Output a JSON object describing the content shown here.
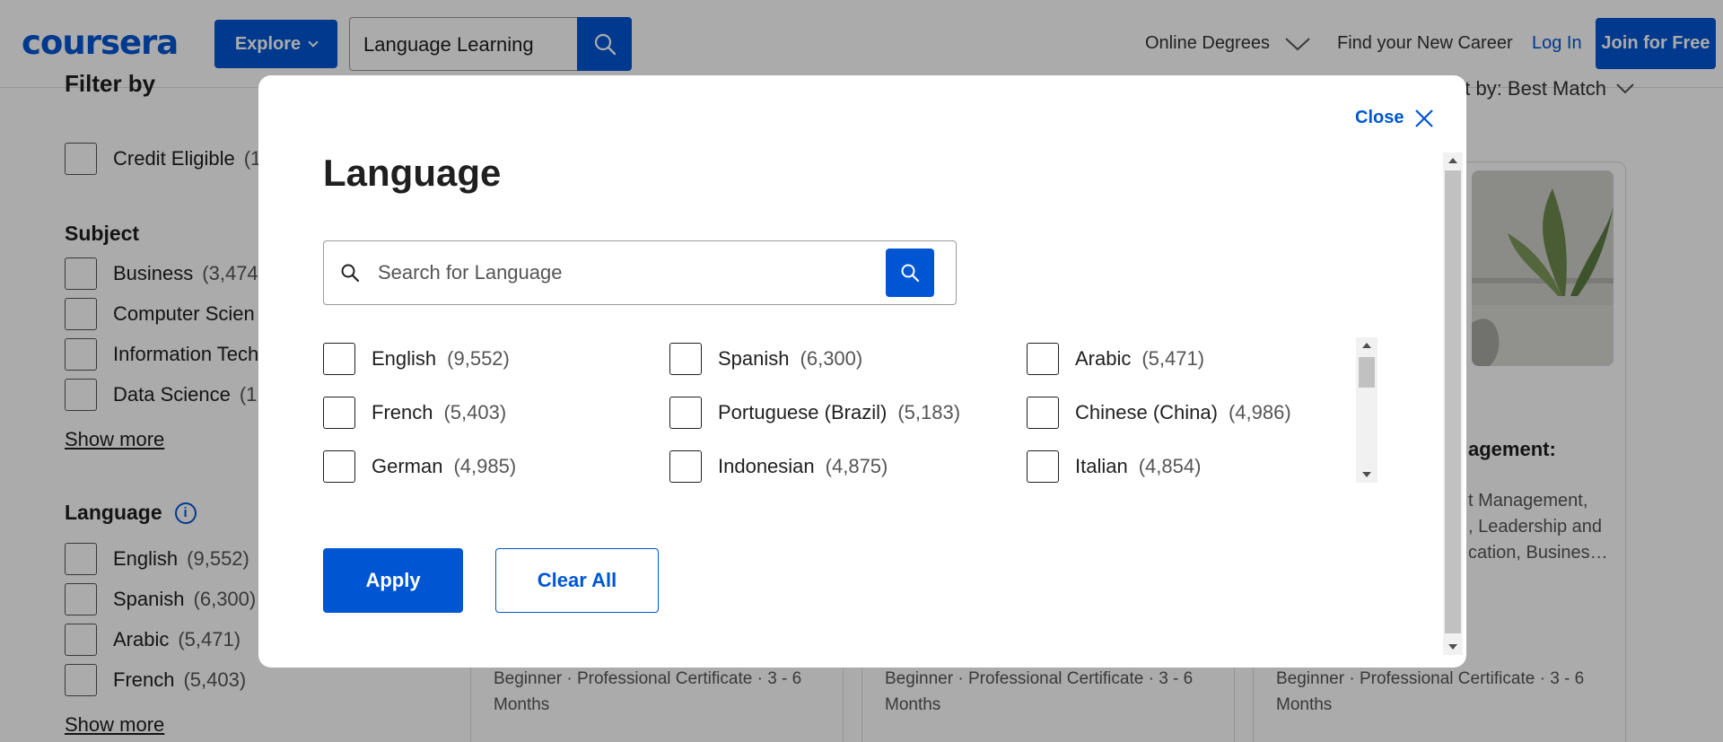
{
  "header": {
    "logo": "coursera",
    "explore_label": "Explore",
    "search_value": "Language Learning",
    "nav_degrees": "Online Degrees",
    "nav_career": "Find your New Career",
    "nav_login": "Log In",
    "join_label": "Join for Free"
  },
  "page": {
    "filter_title": "Filter by",
    "sort_label": "Sort by: Best Match",
    "credit_eligible": {
      "label": "Credit Eligible",
      "count": "(1"
    },
    "subject": {
      "title": "Subject",
      "items": [
        {
          "label": "Business",
          "count": "(3,474"
        },
        {
          "label": "Computer Scien",
          "count": ""
        },
        {
          "label": "Information Tech",
          "count": ""
        },
        {
          "label": "Data Science",
          "count": "(1,"
        }
      ],
      "show_more": "Show more"
    },
    "language": {
      "title": "Language",
      "info_icon": "i",
      "items": [
        {
          "label": "English",
          "count": "(9,552)"
        },
        {
          "label": "Spanish",
          "count": "(6,300)"
        },
        {
          "label": "Arabic",
          "count": "(5,471)"
        },
        {
          "label": "French",
          "count": "(5,403)"
        }
      ],
      "show_more": "Show more"
    },
    "card": {
      "title": "agement:",
      "skills": [
        "t Management,",
        ", Leadership and",
        "cation, Busines…"
      ]
    },
    "card_meta": [
      "Beginner · Professional Certificate · 3 - 6 Months",
      "Beginner · Professional Certificate · 3 - 6 Months",
      "Beginner · Professional Certificate · 3 - 6 Months"
    ]
  },
  "modal": {
    "close_label": "Close",
    "title": "Language",
    "search_placeholder": "Search for Language",
    "languages": [
      {
        "name": "English",
        "count": "(9,552)"
      },
      {
        "name": "Spanish",
        "count": "(6,300)"
      },
      {
        "name": "Arabic",
        "count": "(5,471)"
      },
      {
        "name": "French",
        "count": "(5,403)"
      },
      {
        "name": "Portuguese (Brazil)",
        "count": "(5,183)"
      },
      {
        "name": "Chinese (China)",
        "count": "(4,986)"
      },
      {
        "name": "German",
        "count": "(4,985)"
      },
      {
        "name": "Indonesian",
        "count": "(4,875)"
      },
      {
        "name": "Italian",
        "count": "(4,854)"
      }
    ],
    "apply_label": "Apply",
    "clear_label": "Clear All"
  },
  "colors": {
    "brand": "#0056d2",
    "overlay": "rgba(0,0,0,0.33)"
  },
  "icons": [
    "search-icon",
    "chevron-down-icon",
    "close-icon",
    "info-icon"
  ]
}
